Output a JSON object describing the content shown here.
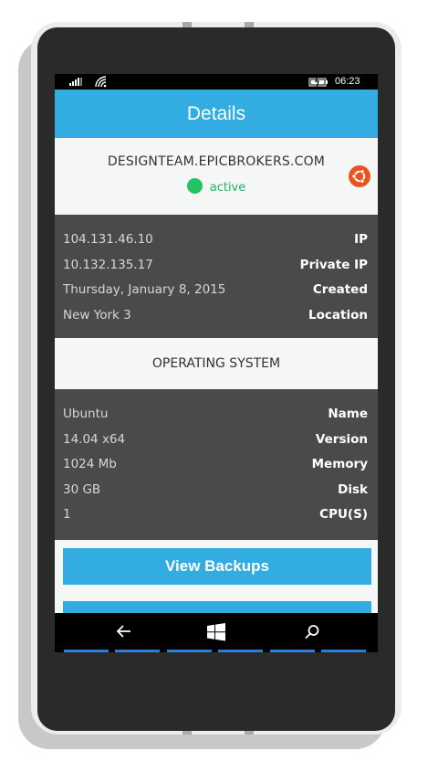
{
  "status_bar": {
    "time": "06:23"
  },
  "header": {
    "title": "Details"
  },
  "host": {
    "name": "DESIGNTEAM.EPICBROKERS.COM",
    "status": "active",
    "os_icon": "ubuntu-icon",
    "status_color": "#22c462"
  },
  "details": [
    {
      "value": "104.131.46.10",
      "label": "IP"
    },
    {
      "value": "10.132.135.17",
      "label": "Private IP"
    },
    {
      "value": "Thursday, January 8, 2015",
      "label": "Created"
    },
    {
      "value": "New York 3",
      "label": "Location"
    }
  ],
  "os_section": {
    "title": "OPERATING SYSTEM"
  },
  "os_details": [
    {
      "value": "Ubuntu",
      "label": "Name"
    },
    {
      "value": "14.04 x64",
      "label": "Version"
    },
    {
      "value": "1024 Mb",
      "label": "Memory"
    },
    {
      "value": "30 GB",
      "label": "Disk"
    },
    {
      "value": "1",
      "label": "CPU(S)"
    }
  ],
  "actions": {
    "view_backups": "View Backups"
  },
  "nav": {
    "back": "back-arrow-icon",
    "home": "windows-logo-icon",
    "search": "search-icon"
  },
  "colors": {
    "accent": "#33ade1",
    "dark_panel": "#4a4a4a",
    "light_panel": "#f5f6f6"
  }
}
